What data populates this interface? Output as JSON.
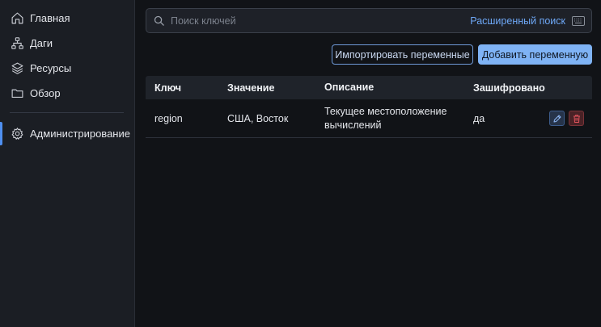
{
  "sidebar": {
    "items": [
      {
        "label": "Главная",
        "icon": "home-icon"
      },
      {
        "label": "Даги",
        "icon": "hierarchy-icon"
      },
      {
        "label": "Ресурсы",
        "icon": "layers-icon"
      },
      {
        "label": "Обзор",
        "icon": "folder-icon"
      },
      {
        "label": "Администрирование",
        "icon": "gear-icon",
        "active": true
      }
    ]
  },
  "search": {
    "placeholder": "Поиск ключей",
    "advanced_label": "Расширенный поиск"
  },
  "toolbar": {
    "import_label": "Импортировать переменные",
    "add_label": "Добавить переменную"
  },
  "table": {
    "headers": [
      "Ключ",
      "Значение",
      "Описание",
      "Зашифровано"
    ],
    "rows": [
      {
        "key": "region",
        "value": "США, Восток",
        "description": "Текущее местоположение вычислений",
        "encrypted": "да"
      }
    ]
  },
  "colors": {
    "accent": "#4f8ff0",
    "primary_button": "#7fb3f5",
    "link": "#6ea8f7",
    "delete": "#e0535c"
  }
}
